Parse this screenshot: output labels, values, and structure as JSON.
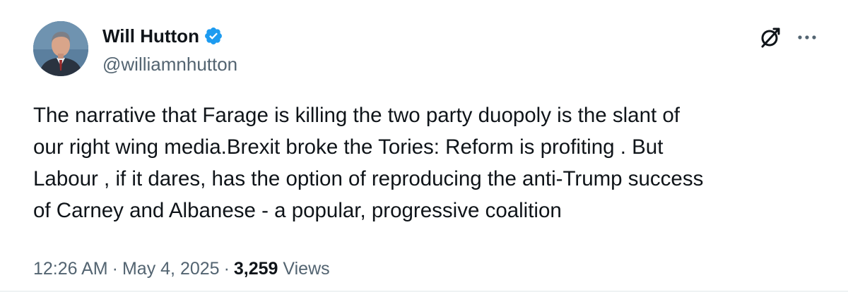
{
  "author": {
    "display_name": "Will Hutton",
    "handle": "@williamnhutton",
    "verified": true,
    "avatar_icon": "profile-photo"
  },
  "actions": {
    "grok_icon": "grok-icon",
    "more_icon": "more-options-icon"
  },
  "tweet": {
    "lines": [
      "The narrative that Farage is killing the two party duopoly is the slant of",
      "our right wing media.Brexit broke the Tories: Reform is profiting . But",
      "Labour , if it dares, has the option of reproducing the anti-Trump success",
      "of Carney and Albanese - a popular, progressive coalition"
    ]
  },
  "meta": {
    "time": "12:26 AM",
    "separator": "·",
    "date": "May 4, 2025",
    "views_count": "3,259",
    "views_label": "Views"
  },
  "colors": {
    "text_primary": "#0f1419",
    "text_secondary": "#536471",
    "verified_blue": "#1d9bf0"
  }
}
